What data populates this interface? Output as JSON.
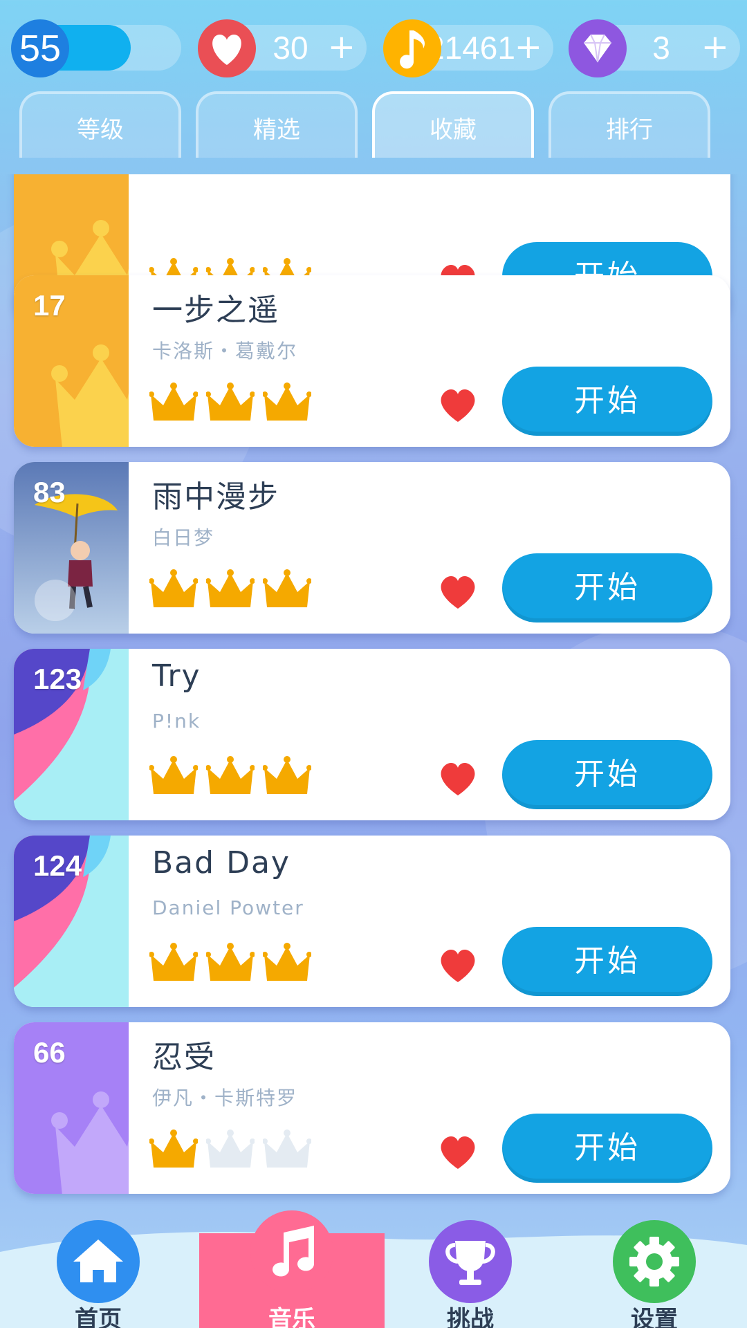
{
  "status": {
    "level": "55",
    "lives": "30",
    "notes": "21461",
    "gems": "3",
    "plus": "+",
    "level_progress": 0.6
  },
  "tabs": [
    {
      "label": "等级"
    },
    {
      "label": "精选"
    },
    {
      "label": "收藏",
      "active": true
    },
    {
      "label": "排行"
    }
  ],
  "songs": [
    {
      "number": "",
      "title": "",
      "artist": "",
      "crowns": 3,
      "favorite": true,
      "start": "开始",
      "thumb": "crown-orange"
    },
    {
      "number": "17",
      "title": "一步之遥",
      "artist": "卡洛斯・葛戴尔",
      "crowns": 3,
      "favorite": true,
      "start": "开始",
      "thumb": "crown-orange"
    },
    {
      "number": "83",
      "title": "雨中漫步",
      "artist": "白日梦",
      "crowns": 3,
      "favorite": true,
      "start": "开始",
      "thumb": "rain-girl"
    },
    {
      "number": "123",
      "title": "Try",
      "artist": "P!nk",
      "crowns": 3,
      "favorite": true,
      "start": "开始",
      "thumb": "wave-blue"
    },
    {
      "number": "124",
      "title": "Bad Day",
      "artist": "Daniel Powter",
      "crowns": 3,
      "favorite": true,
      "start": "开始",
      "thumb": "wave-blue"
    },
    {
      "number": "66",
      "title": "忍受",
      "artist": "伊凡・卡斯特罗",
      "crowns": 1,
      "favorite": true,
      "start": "开始",
      "thumb": "crown-purple"
    }
  ],
  "nav": [
    {
      "label": "首页",
      "icon": "home-icon",
      "color": "#2f8ff0"
    },
    {
      "label": "音乐",
      "icon": "music-note-icon",
      "color": "#ff6b93",
      "active": true
    },
    {
      "label": "挑战",
      "icon": "trophy-icon",
      "color": "#8a5ce6"
    },
    {
      "label": "设置",
      "icon": "gear-icon",
      "color": "#3fbf5c"
    }
  ],
  "colors": {
    "accent": "#13a3e3",
    "crown": "#f5a900",
    "heart": "#ef3b3b"
  }
}
